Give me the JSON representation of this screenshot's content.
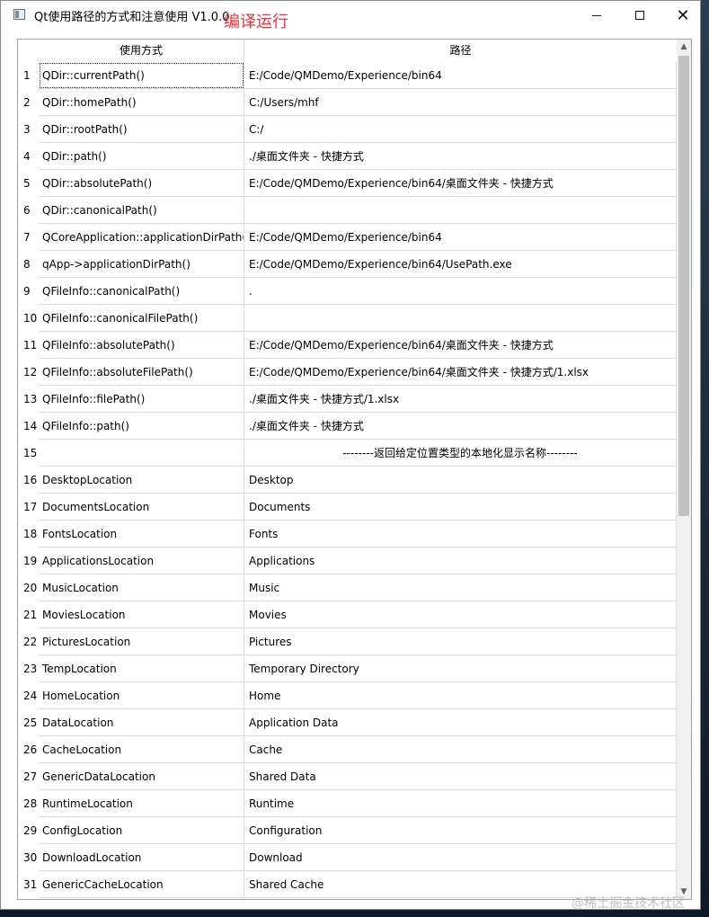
{
  "window": {
    "title": "Qt使用路径的方式和注意使用 V1.0.0",
    "note": "编译运行",
    "min_icon": "minimize-icon",
    "max_icon": "maximize-icon",
    "close_label": "✕"
  },
  "table": {
    "headers": [
      "使用方式",
      "路径"
    ],
    "rows": [
      {
        "n": "1",
        "method": "QDir::currentPath()",
        "path": "E:/Code/QMDemo/Experience/bin64"
      },
      {
        "n": "2",
        "method": "QDir::homePath()",
        "path": "C:/Users/mhf"
      },
      {
        "n": "3",
        "method": "QDir::rootPath()",
        "path": "C:/"
      },
      {
        "n": "4",
        "method": "QDir::path()",
        "path": "./桌面文件夹 - 快捷方式"
      },
      {
        "n": "5",
        "method": "QDir::absolutePath()",
        "path": "E:/Code/QMDemo/Experience/bin64/桌面文件夹 - 快捷方式"
      },
      {
        "n": "6",
        "method": "QDir::canonicalPath()",
        "path": ""
      },
      {
        "n": "7",
        "method": "QCoreApplication::applicationDirPath()",
        "path": "E:/Code/QMDemo/Experience/bin64"
      },
      {
        "n": "8",
        "method": "qApp->applicationDirPath()",
        "path": "E:/Code/QMDemo/Experience/bin64/UsePath.exe"
      },
      {
        "n": "9",
        "method": "QFileInfo::canonicalPath()",
        "path": "."
      },
      {
        "n": "10",
        "method": "QFileInfo::canonicalFilePath()",
        "path": ""
      },
      {
        "n": "11",
        "method": "QFileInfo::absolutePath()",
        "path": "E:/Code/QMDemo/Experience/bin64/桌面文件夹 - 快捷方式"
      },
      {
        "n": "12",
        "method": "QFileInfo::absoluteFilePath()",
        "path": "E:/Code/QMDemo/Experience/bin64/桌面文件夹 - 快捷方式/1.xlsx"
      },
      {
        "n": "13",
        "method": "QFileInfo::filePath()",
        "path": "./桌面文件夹 - 快捷方式/1.xlsx"
      },
      {
        "n": "14",
        "method": "QFileInfo::path()",
        "path": "./桌面文件夹 - 快捷方式"
      },
      {
        "n": "15",
        "method": "",
        "path": "--------返回给定位置类型的本地化显示名称--------"
      },
      {
        "n": "16",
        "method": "DesktopLocation",
        "path": "Desktop"
      },
      {
        "n": "17",
        "method": "DocumentsLocation",
        "path": "Documents"
      },
      {
        "n": "18",
        "method": "FontsLocation",
        "path": "Fonts"
      },
      {
        "n": "19",
        "method": "ApplicationsLocation",
        "path": "Applications"
      },
      {
        "n": "20",
        "method": "MusicLocation",
        "path": "Music"
      },
      {
        "n": "21",
        "method": "MoviesLocation",
        "path": "Movies"
      },
      {
        "n": "22",
        "method": "PicturesLocation",
        "path": "Pictures"
      },
      {
        "n": "23",
        "method": "TempLocation",
        "path": "Temporary Directory"
      },
      {
        "n": "24",
        "method": "HomeLocation",
        "path": "Home"
      },
      {
        "n": "25",
        "method": "DataLocation",
        "path": "Application Data"
      },
      {
        "n": "26",
        "method": "CacheLocation",
        "path": "Cache"
      },
      {
        "n": "27",
        "method": "GenericDataLocation",
        "path": "Shared Data"
      },
      {
        "n": "28",
        "method": "RuntimeLocation",
        "path": "Runtime"
      },
      {
        "n": "29",
        "method": "ConfigLocation",
        "path": "Configuration"
      },
      {
        "n": "30",
        "method": "DownloadLocation",
        "path": "Download"
      },
      {
        "n": "31",
        "method": "GenericCacheLocation",
        "path": "Shared Cache"
      }
    ]
  },
  "scrollbar": {
    "up_icon": "▲",
    "down_icon": "▼"
  },
  "watermark": "@稀土掘金技术社区",
  "colors": {
    "note": "#e8333a",
    "grid": "#dadada",
    "scroll_thumb": "#c1c1c1"
  }
}
